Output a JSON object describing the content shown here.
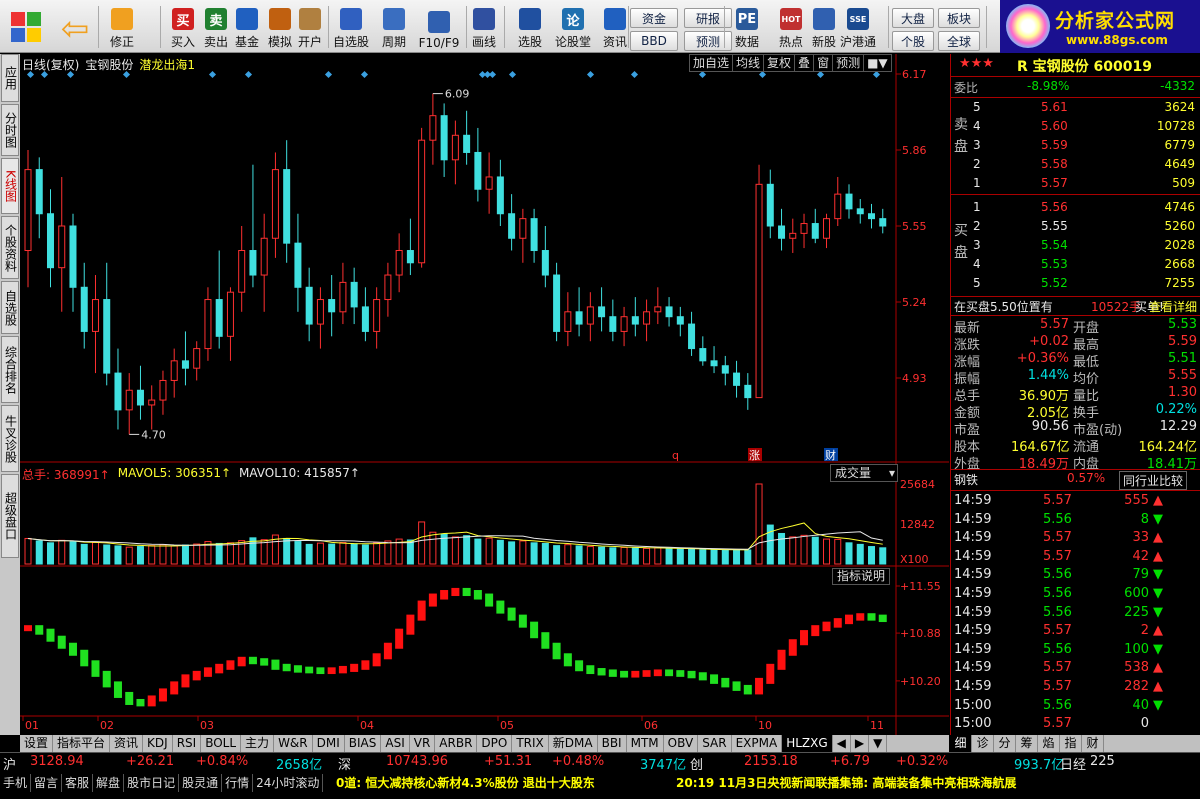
{
  "toolbar": {
    "buttons": [
      {
        "label": "修正",
        "icon": "up-down-arrows-icon"
      },
      {
        "label": "买入",
        "icon": "buy-icon",
        "glyph": "买"
      },
      {
        "label": "卖出",
        "icon": "sell-icon",
        "glyph": "卖"
      },
      {
        "label": "基金",
        "icon": "fund-icon"
      },
      {
        "label": "模拟",
        "icon": "gavel-icon"
      },
      {
        "label": "开户",
        "icon": "lock-icon"
      },
      {
        "label": "自选股",
        "icon": "star-icon"
      },
      {
        "label": "周期",
        "icon": "clock-icon"
      },
      {
        "label": "F10/F9",
        "icon": "f10-icon"
      },
      {
        "label": "画线",
        "icon": "pen-icon"
      },
      {
        "label": "选股",
        "icon": "screen-icon"
      },
      {
        "label": "论股堂",
        "icon": "forum-icon",
        "glyph": "论"
      },
      {
        "label": "资讯",
        "icon": "news-icon"
      },
      {
        "label": "数据",
        "icon": "pe-icon",
        "glyph": "PE"
      },
      {
        "label": "热点",
        "icon": "hot-icon",
        "glyph": "HOT"
      },
      {
        "label": "新股",
        "icon": "new-stock-icon"
      },
      {
        "label": "沪港通",
        "icon": "sse-hkex-icon",
        "glyph": "SSE HKE"
      }
    ],
    "small_buttons": [
      "资金",
      "BBD",
      "研报",
      "预测",
      "大盘",
      "个股",
      "板块",
      "全球"
    ],
    "logo": {
      "title": "分析家公式网",
      "url": "www.88gs.com"
    }
  },
  "left_tabs": [
    "应用",
    "分时图",
    "K线图",
    "个股资料",
    "自选股",
    "综合排名",
    "牛叉诊股",
    "超级盘口"
  ],
  "chart_header": {
    "mode": "日线(复权)",
    "stock": "宝钢股份",
    "indicator": "潜龙出海1",
    "buttons": [
      "加自选",
      "均线",
      "复权",
      "叠",
      "窗",
      "预测",
      "■▼"
    ]
  },
  "volume_header": {
    "total": "总手: 368991↑",
    "ma5": "MAVOL5: 306351↑",
    "ma10": "MAVOL10: 415857↑",
    "dropdown": "成交量"
  },
  "indicator_label": "指标说明",
  "price_axis": [
    "6.17",
    "5.86",
    "5.55",
    "5.24",
    "4.93"
  ],
  "vol_axis": [
    "25684",
    "12842",
    "X100"
  ],
  "ind_axis": [
    "+11.55",
    "+10.88",
    "+10.20"
  ],
  "date_axis": [
    "01",
    "02",
    "03",
    "04",
    "05",
    "06",
    "10",
    "11"
  ],
  "annotations": {
    "high": "6.09",
    "low": "4.70",
    "mark_q": "q",
    "mark_zhang": "涨",
    "mark_cai": "财"
  },
  "chart_data": [
    {
      "type": "candlestick",
      "title": "日线(复权) 宝钢股份",
      "ylim": [
        4.62,
        6.17
      ],
      "x": [
        "01",
        "02",
        "03",
        "04",
        "05",
        "06",
        "10",
        "11"
      ],
      "ohlc": [
        [
          5.45,
          5.86,
          5.3,
          5.78
        ],
        [
          5.78,
          5.83,
          5.5,
          5.6
        ],
        [
          5.6,
          5.7,
          5.3,
          5.38
        ],
        [
          5.38,
          5.75,
          5.2,
          5.55
        ],
        [
          5.55,
          5.6,
          5.2,
          5.3
        ],
        [
          5.3,
          5.4,
          5.05,
          5.12
        ],
        [
          5.12,
          5.35,
          4.95,
          5.25
        ],
        [
          5.25,
          5.4,
          4.9,
          4.95
        ],
        [
          4.95,
          5.05,
          4.72,
          4.8
        ],
        [
          4.8,
          4.95,
          4.7,
          4.88
        ],
        [
          4.88,
          4.98,
          4.76,
          4.82
        ],
        [
          4.82,
          4.9,
          4.72,
          4.84
        ],
        [
          4.84,
          4.96,
          4.78,
          4.92
        ],
        [
          4.92,
          5.05,
          4.85,
          5.0
        ],
        [
          5.0,
          5.12,
          4.9,
          4.97
        ],
        [
          4.97,
          5.08,
          4.92,
          5.05
        ],
        [
          5.05,
          5.3,
          5.0,
          5.25
        ],
        [
          5.25,
          5.45,
          5.05,
          5.1
        ],
        [
          5.1,
          5.3,
          5.0,
          5.28
        ],
        [
          5.28,
          5.55,
          5.2,
          5.45
        ],
        [
          5.45,
          5.8,
          5.3,
          5.35
        ],
        [
          5.35,
          5.6,
          5.2,
          5.5
        ],
        [
          5.5,
          5.85,
          5.42,
          5.78
        ],
        [
          5.78,
          5.9,
          5.4,
          5.48
        ],
        [
          5.48,
          5.6,
          5.2,
          5.3
        ],
        [
          5.3,
          5.38,
          5.08,
          5.15
        ],
        [
          5.15,
          5.3,
          5.05,
          5.25
        ],
        [
          5.25,
          5.35,
          5.1,
          5.2
        ],
        [
          5.2,
          5.4,
          5.15,
          5.32
        ],
        [
          5.32,
          5.38,
          5.15,
          5.22
        ],
        [
          5.22,
          5.3,
          5.08,
          5.12
        ],
        [
          5.12,
          5.3,
          5.05,
          5.25
        ],
        [
          5.25,
          5.4,
          5.18,
          5.35
        ],
        [
          5.35,
          5.52,
          5.28,
          5.45
        ],
        [
          5.45,
          5.58,
          5.35,
          5.4
        ],
        [
          5.4,
          5.95,
          5.38,
          5.9
        ],
        [
          5.9,
          6.09,
          5.8,
          6.0
        ],
        [
          6.0,
          6.05,
          5.75,
          5.82
        ],
        [
          5.82,
          5.98,
          5.72,
          5.92
        ],
        [
          5.92,
          6.02,
          5.8,
          5.85
        ],
        [
          5.85,
          5.95,
          5.65,
          5.7
        ],
        [
          5.7,
          5.85,
          5.6,
          5.75
        ],
        [
          5.75,
          5.82,
          5.55,
          5.6
        ],
        [
          5.6,
          5.68,
          5.45,
          5.5
        ],
        [
          5.5,
          5.62,
          5.4,
          5.58
        ],
        [
          5.58,
          5.62,
          5.4,
          5.45
        ],
        [
          5.45,
          5.55,
          5.3,
          5.35
        ],
        [
          5.35,
          5.4,
          5.08,
          5.12
        ],
        [
          5.12,
          5.28,
          5.06,
          5.2
        ],
        [
          5.2,
          5.3,
          5.1,
          5.15
        ],
        [
          5.15,
          5.28,
          5.08,
          5.22
        ],
        [
          5.22,
          5.3,
          5.12,
          5.18
        ],
        [
          5.18,
          5.25,
          5.08,
          5.12
        ],
        [
          5.12,
          5.22,
          5.06,
          5.18
        ],
        [
          5.18,
          5.26,
          5.1,
          5.15
        ],
        [
          5.15,
          5.25,
          5.08,
          5.2
        ],
        [
          5.2,
          5.3,
          5.15,
          5.22
        ],
        [
          5.22,
          5.26,
          5.14,
          5.18
        ],
        [
          5.18,
          5.22,
          5.1,
          5.15
        ],
        [
          5.15,
          5.2,
          5.02,
          5.05
        ],
        [
          5.05,
          5.1,
          4.98,
          5.0
        ],
        [
          5.0,
          5.06,
          4.95,
          4.98
        ],
        [
          4.98,
          5.02,
          4.9,
          4.95
        ],
        [
          4.95,
          5.0,
          4.85,
          4.9
        ],
        [
          4.9,
          4.95,
          4.8,
          4.85
        ],
        [
          4.85,
          5.8,
          4.85,
          5.72
        ],
        [
          5.72,
          5.78,
          5.5,
          5.55
        ],
        [
          5.55,
          5.62,
          5.45,
          5.5
        ],
        [
          5.5,
          5.58,
          5.44,
          5.52
        ],
        [
          5.52,
          5.6,
          5.46,
          5.56
        ],
        [
          5.56,
          5.62,
          5.48,
          5.5
        ],
        [
          5.5,
          5.6,
          5.46,
          5.58
        ],
        [
          5.58,
          5.75,
          5.55,
          5.68
        ],
        [
          5.68,
          5.72,
          5.58,
          5.62
        ],
        [
          5.62,
          5.66,
          5.56,
          5.6
        ],
        [
          5.6,
          5.64,
          5.54,
          5.58
        ],
        [
          5.58,
          5.62,
          5.52,
          5.55
        ]
      ]
    },
    {
      "type": "bar",
      "title": "成交量",
      "ylim": [
        0,
        25684
      ],
      "values": [
        8200,
        7400,
        6800,
        7600,
        7100,
        6300,
        6900,
        6100,
        5800,
        5400,
        5600,
        5900,
        6200,
        5800,
        6100,
        6400,
        7200,
        6600,
        6800,
        7500,
        8400,
        7800,
        9300,
        8200,
        7200,
        6300,
        6700,
        6400,
        6900,
        6500,
        6100,
        6800,
        7400,
        8000,
        7700,
        13500,
        10200,
        9600,
        8700,
        9100,
        8000,
        8300,
        7600,
        7100,
        7400,
        6800,
        6600,
        5900,
        6200,
        5800,
        5600,
        5400,
        5200,
        5300,
        5100,
        5000,
        5200,
        4900,
        4800,
        4700,
        4600,
        4500,
        4400,
        4600,
        4500,
        25684,
        12500,
        9800,
        8700,
        9200,
        8600,
        8000,
        7900,
        6800,
        6300,
        5600,
        5200
      ]
    },
    {
      "type": "bar",
      "title": "潜龙出海1",
      "ylim": [
        9.8,
        11.55
      ],
      "values": [
        10.95,
        10.9,
        10.8,
        10.7,
        10.6,
        10.45,
        10.3,
        10.15,
        10.0,
        9.9,
        9.88,
        9.95,
        10.05,
        10.15,
        10.25,
        10.3,
        10.35,
        10.4,
        10.45,
        10.5,
        10.48,
        10.46,
        10.4,
        10.38,
        10.36,
        10.35,
        10.34,
        10.35,
        10.37,
        10.4,
        10.45,
        10.55,
        10.7,
        10.9,
        11.1,
        11.3,
        11.4,
        11.45,
        11.48,
        11.45,
        11.4,
        11.3,
        11.2,
        11.1,
        11.0,
        10.85,
        10.7,
        10.55,
        10.45,
        10.38,
        10.34,
        10.32,
        10.3,
        10.29,
        10.3,
        10.31,
        10.32,
        10.31,
        10.3,
        10.28,
        10.25,
        10.2,
        10.15,
        10.1,
        10.05,
        10.2,
        10.4,
        10.6,
        10.75,
        10.88,
        10.95,
        11.0,
        11.05,
        11.1,
        11.12,
        11.1,
        11.08
      ]
    }
  ],
  "quote": {
    "title": "R 宝钢股份 600019",
    "weibi": {
      "label": "委比",
      "pct": "-8.98%",
      "val": "-4332"
    },
    "sell": [
      {
        "lvl": "5",
        "price": "5.61",
        "vol": "3624"
      },
      {
        "lvl": "4",
        "price": "5.60",
        "vol": "10728"
      },
      {
        "lvl": "3",
        "price": "5.59",
        "vol": "6779"
      },
      {
        "lvl": "2",
        "price": "5.58",
        "vol": "4649"
      },
      {
        "lvl": "1",
        "price": "5.57",
        "vol": "509"
      }
    ],
    "buy": [
      {
        "lvl": "1",
        "price": "5.56",
        "vol": "4746"
      },
      {
        "lvl": "2",
        "price": "5.55",
        "vol": "5260"
      },
      {
        "lvl": "3",
        "price": "5.54",
        "vol": "2028"
      },
      {
        "lvl": "4",
        "price": "5.53",
        "vol": "2668"
      },
      {
        "lvl": "5",
        "price": "5.52",
        "vol": "7255"
      }
    ],
    "sell_label": "卖盘",
    "buy_label": "买盘",
    "order_line": {
      "a": "在买盘5.50位置有",
      "b": "10522手",
      "c": "买单!",
      "d": "查看详细"
    },
    "stats": [
      [
        "最新",
        "5.57",
        "开盘",
        "5.53"
      ],
      [
        "涨跌",
        "+0.02",
        "最高",
        "5.59"
      ],
      [
        "涨幅",
        "+0.36%",
        "最低",
        "5.51"
      ],
      [
        "振幅",
        "1.44%",
        "均价",
        "5.55"
      ],
      [
        "总手",
        "36.90万",
        "量比",
        "1.30"
      ],
      [
        "金额",
        "2.05亿",
        "换手",
        "0.22%"
      ],
      [
        "市盈",
        "90.56",
        "市盈(动)",
        "12.29"
      ],
      [
        "股本",
        "164.67亿",
        "流通",
        "164.24亿"
      ],
      [
        "外盘",
        "18.49万",
        "内盘",
        "18.41万"
      ]
    ],
    "industry": {
      "name": "钢铁",
      "pct": "0.57%",
      "btn": "同行业比较"
    },
    "ticks": [
      [
        "14:59",
        "5.57",
        "555",
        "up"
      ],
      [
        "14:59",
        "5.56",
        "8",
        "down"
      ],
      [
        "14:59",
        "5.57",
        "33",
        "up"
      ],
      [
        "14:59",
        "5.57",
        "42",
        "up"
      ],
      [
        "14:59",
        "5.56",
        "79",
        "down"
      ],
      [
        "14:59",
        "5.56",
        "600",
        "down"
      ],
      [
        "14:59",
        "5.56",
        "225",
        "down"
      ],
      [
        "14:59",
        "5.57",
        "2",
        "up"
      ],
      [
        "14:59",
        "5.56",
        "100",
        "down"
      ],
      [
        "14:59",
        "5.57",
        "538",
        "up"
      ],
      [
        "14:59",
        "5.57",
        "282",
        "up"
      ],
      [
        "15:00",
        "5.56",
        "40",
        "down"
      ],
      [
        "15:00",
        "5.57",
        "0",
        "none"
      ]
    ]
  },
  "bottom_tabs": [
    "设置",
    "指标平台",
    "资讯",
    "KDJ",
    "RSI",
    "BOLL",
    "主力",
    "W&R",
    "DMI",
    "BIAS",
    "ASI",
    "VR",
    "ARBR",
    "DPO",
    "TRIX",
    "新DMA",
    "BBI",
    "MTM",
    "OBV",
    "SAR",
    "EXPMA",
    "HLZXG"
  ],
  "right_tabs": [
    "细",
    "诊",
    "分",
    "筹",
    "焰",
    "指",
    "财"
  ],
  "status": {
    "sh_label": "沪",
    "sh_idx": "3128.94",
    "sh_chg": "+26.21",
    "sh_pct": "+0.84%",
    "sh_amt": "2658亿",
    "sz_label": "深",
    "sz_idx": "10743.96",
    "sz_chg": "+51.31",
    "sz_pct": "+0.48%",
    "sz_amt": "3747亿",
    "cy_label": "创",
    "cy_idx": "2153.18",
    "cy_chg": "+6.79",
    "cy_pct": "+0.32%",
    "cy_amt": "993.7亿",
    "rj_label": "日经",
    "rj_idx": "225",
    "links": [
      "手机",
      "留言",
      "客服",
      "解盘",
      "股市日记",
      "股灵通",
      "行情",
      "24小时滚动"
    ],
    "ticker1": "0道: 恒大减持核心新材4.3%股份 退出十大股东",
    "ticker2": "20:19 11月3日央视新闻联播集锦: 高端装备集中亮相珠海航展"
  }
}
